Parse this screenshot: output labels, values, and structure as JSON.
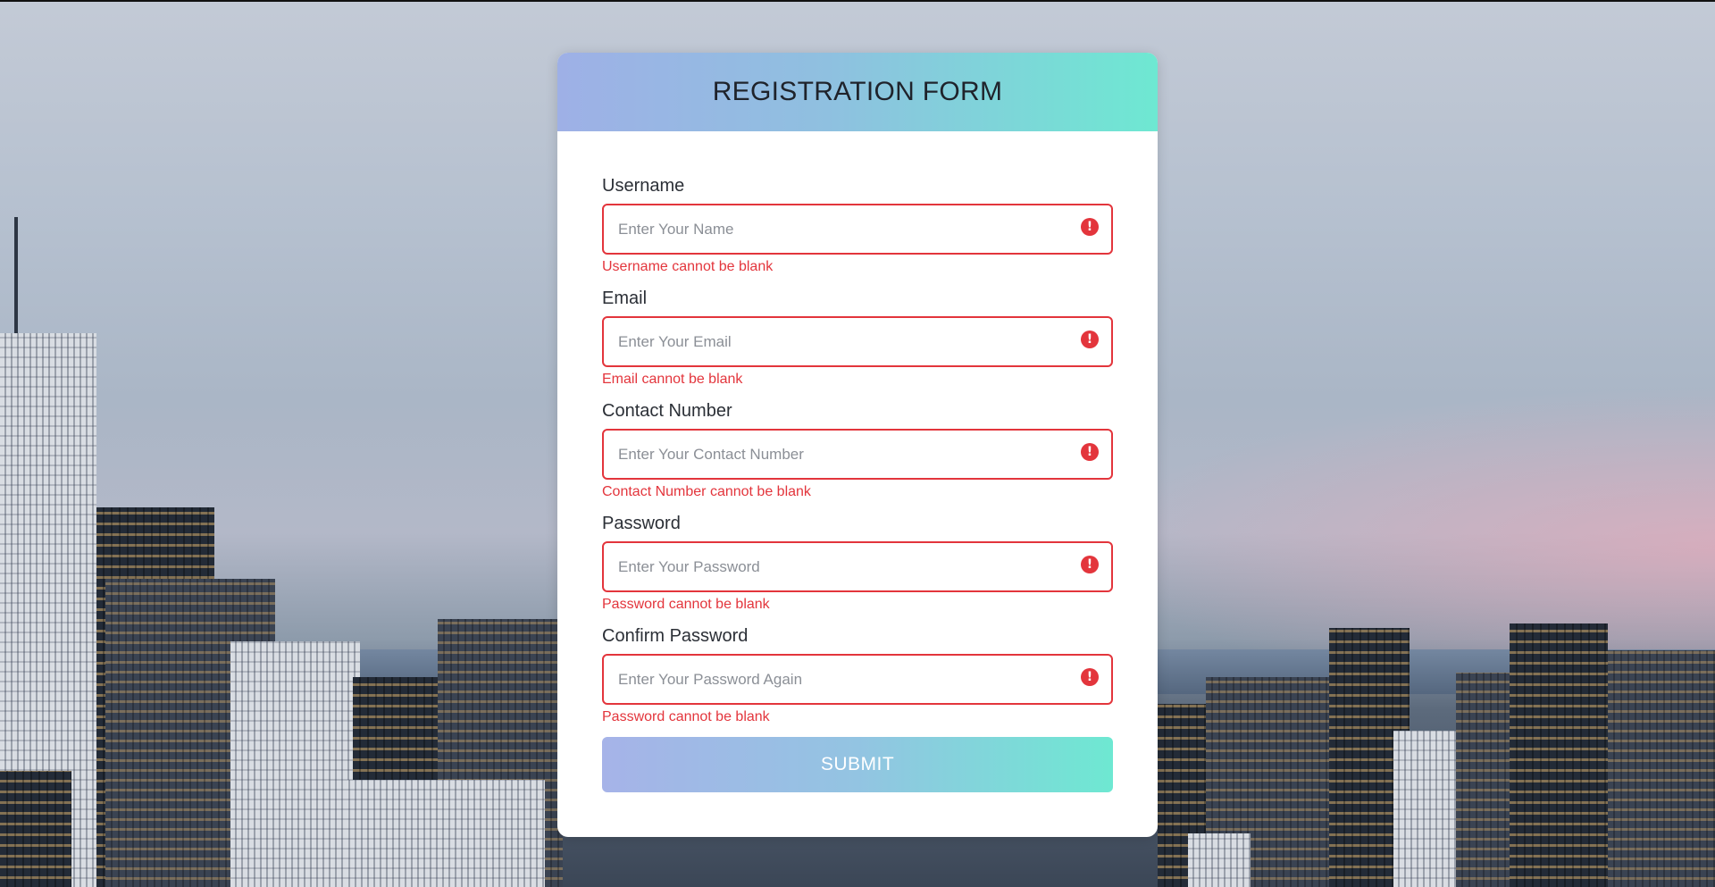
{
  "form": {
    "title": "REGISTRATION FORM",
    "fields": [
      {
        "label": "Username",
        "placeholder": "Enter Your Name",
        "value": "",
        "error": "Username cannot be blank"
      },
      {
        "label": "Email",
        "placeholder": "Enter Your Email",
        "value": "",
        "error": "Email cannot be blank"
      },
      {
        "label": "Contact Number",
        "placeholder": "Enter Your Contact Number",
        "value": "",
        "error": "Contact Number cannot be blank"
      },
      {
        "label": "Password",
        "placeholder": "Enter Your Password",
        "value": "",
        "error": "Password cannot be blank"
      },
      {
        "label": "Confirm Password",
        "placeholder": "Enter Your Password Again",
        "value": "",
        "error": "Password cannot be blank"
      }
    ],
    "error_icon": "!",
    "submit_label": "SUBMIT"
  },
  "icons": {
    "error": "exclamation-circle-icon"
  },
  "colors": {
    "error": "#e3353c",
    "header_gradient_start": "#9eb0e6",
    "header_gradient_end": "#6ee8d2",
    "card_background": "#ffffff"
  }
}
